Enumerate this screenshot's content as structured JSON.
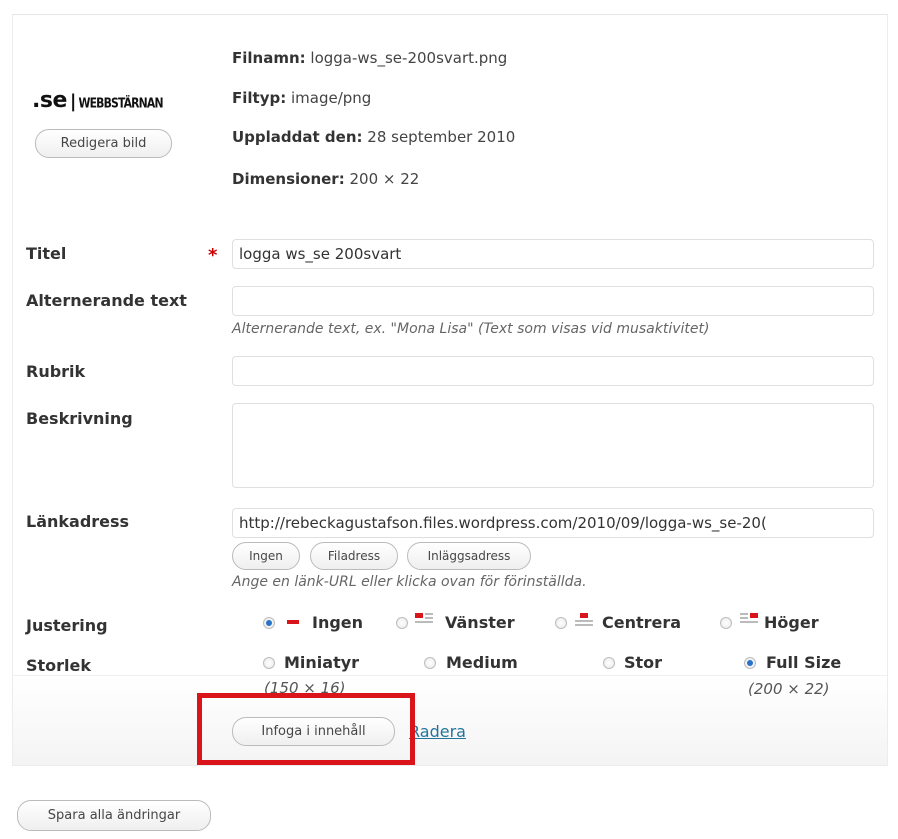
{
  "logo": {
    "se": ".se",
    "separator": "|",
    "brand": "WEBBSTÄRNAN"
  },
  "image_meta": {
    "filename": {
      "label": "Filnamn:",
      "value": "logga-ws_se-200svart.png"
    },
    "filetype": {
      "label": "Filtyp:",
      "value": "image/png"
    },
    "uploaded": {
      "label": "Uppladdat den:",
      "value": "28 september 2010"
    },
    "dimensions": {
      "label": "Dimensioner:",
      "value": "200 × 22"
    }
  },
  "buttons": {
    "edit_image": "Redigera bild",
    "insert": "Infoga i innehåll",
    "delete": "Radera",
    "save_all": "Spara alla ändringar"
  },
  "form": {
    "title": {
      "label": "Titel",
      "required": "*",
      "value": "logga ws_se 200svart"
    },
    "alt_text": {
      "label": "Alternerande text",
      "value": "",
      "help": "Alternerande text, ex. \"Mona Lisa\" (Text som visas vid musaktivitet)"
    },
    "caption": {
      "label": "Rubrik",
      "value": ""
    },
    "description": {
      "label": "Beskrivning",
      "value": ""
    },
    "link": {
      "label": "Länkadress",
      "value": "http://rebeckagustafson.files.wordpress.com/2010/09/logga-ws_se-20(",
      "buttons": [
        "Ingen",
        "Filadress",
        "Inläggsadress"
      ],
      "help": "Ange en länk-URL eller klicka ovan för förinställda."
    },
    "alignment": {
      "label": "Justering",
      "options": [
        "Ingen",
        "Vänster",
        "Centrera",
        "Höger"
      ],
      "selected": "Ingen"
    },
    "size": {
      "label": "Storlek",
      "options": [
        {
          "label": "Miniatyr",
          "dims": "(150 × 16)"
        },
        {
          "label": "Medium",
          "dims": ""
        },
        {
          "label": "Stor",
          "dims": ""
        },
        {
          "label": "Full Size",
          "dims": "(200 × 22)"
        }
      ],
      "selected": "Full Size"
    }
  },
  "colors": {
    "highlight": "#d9141b",
    "link": "#21759b",
    "required": "#cc0000",
    "radio_checked": "#2a72c8"
  }
}
